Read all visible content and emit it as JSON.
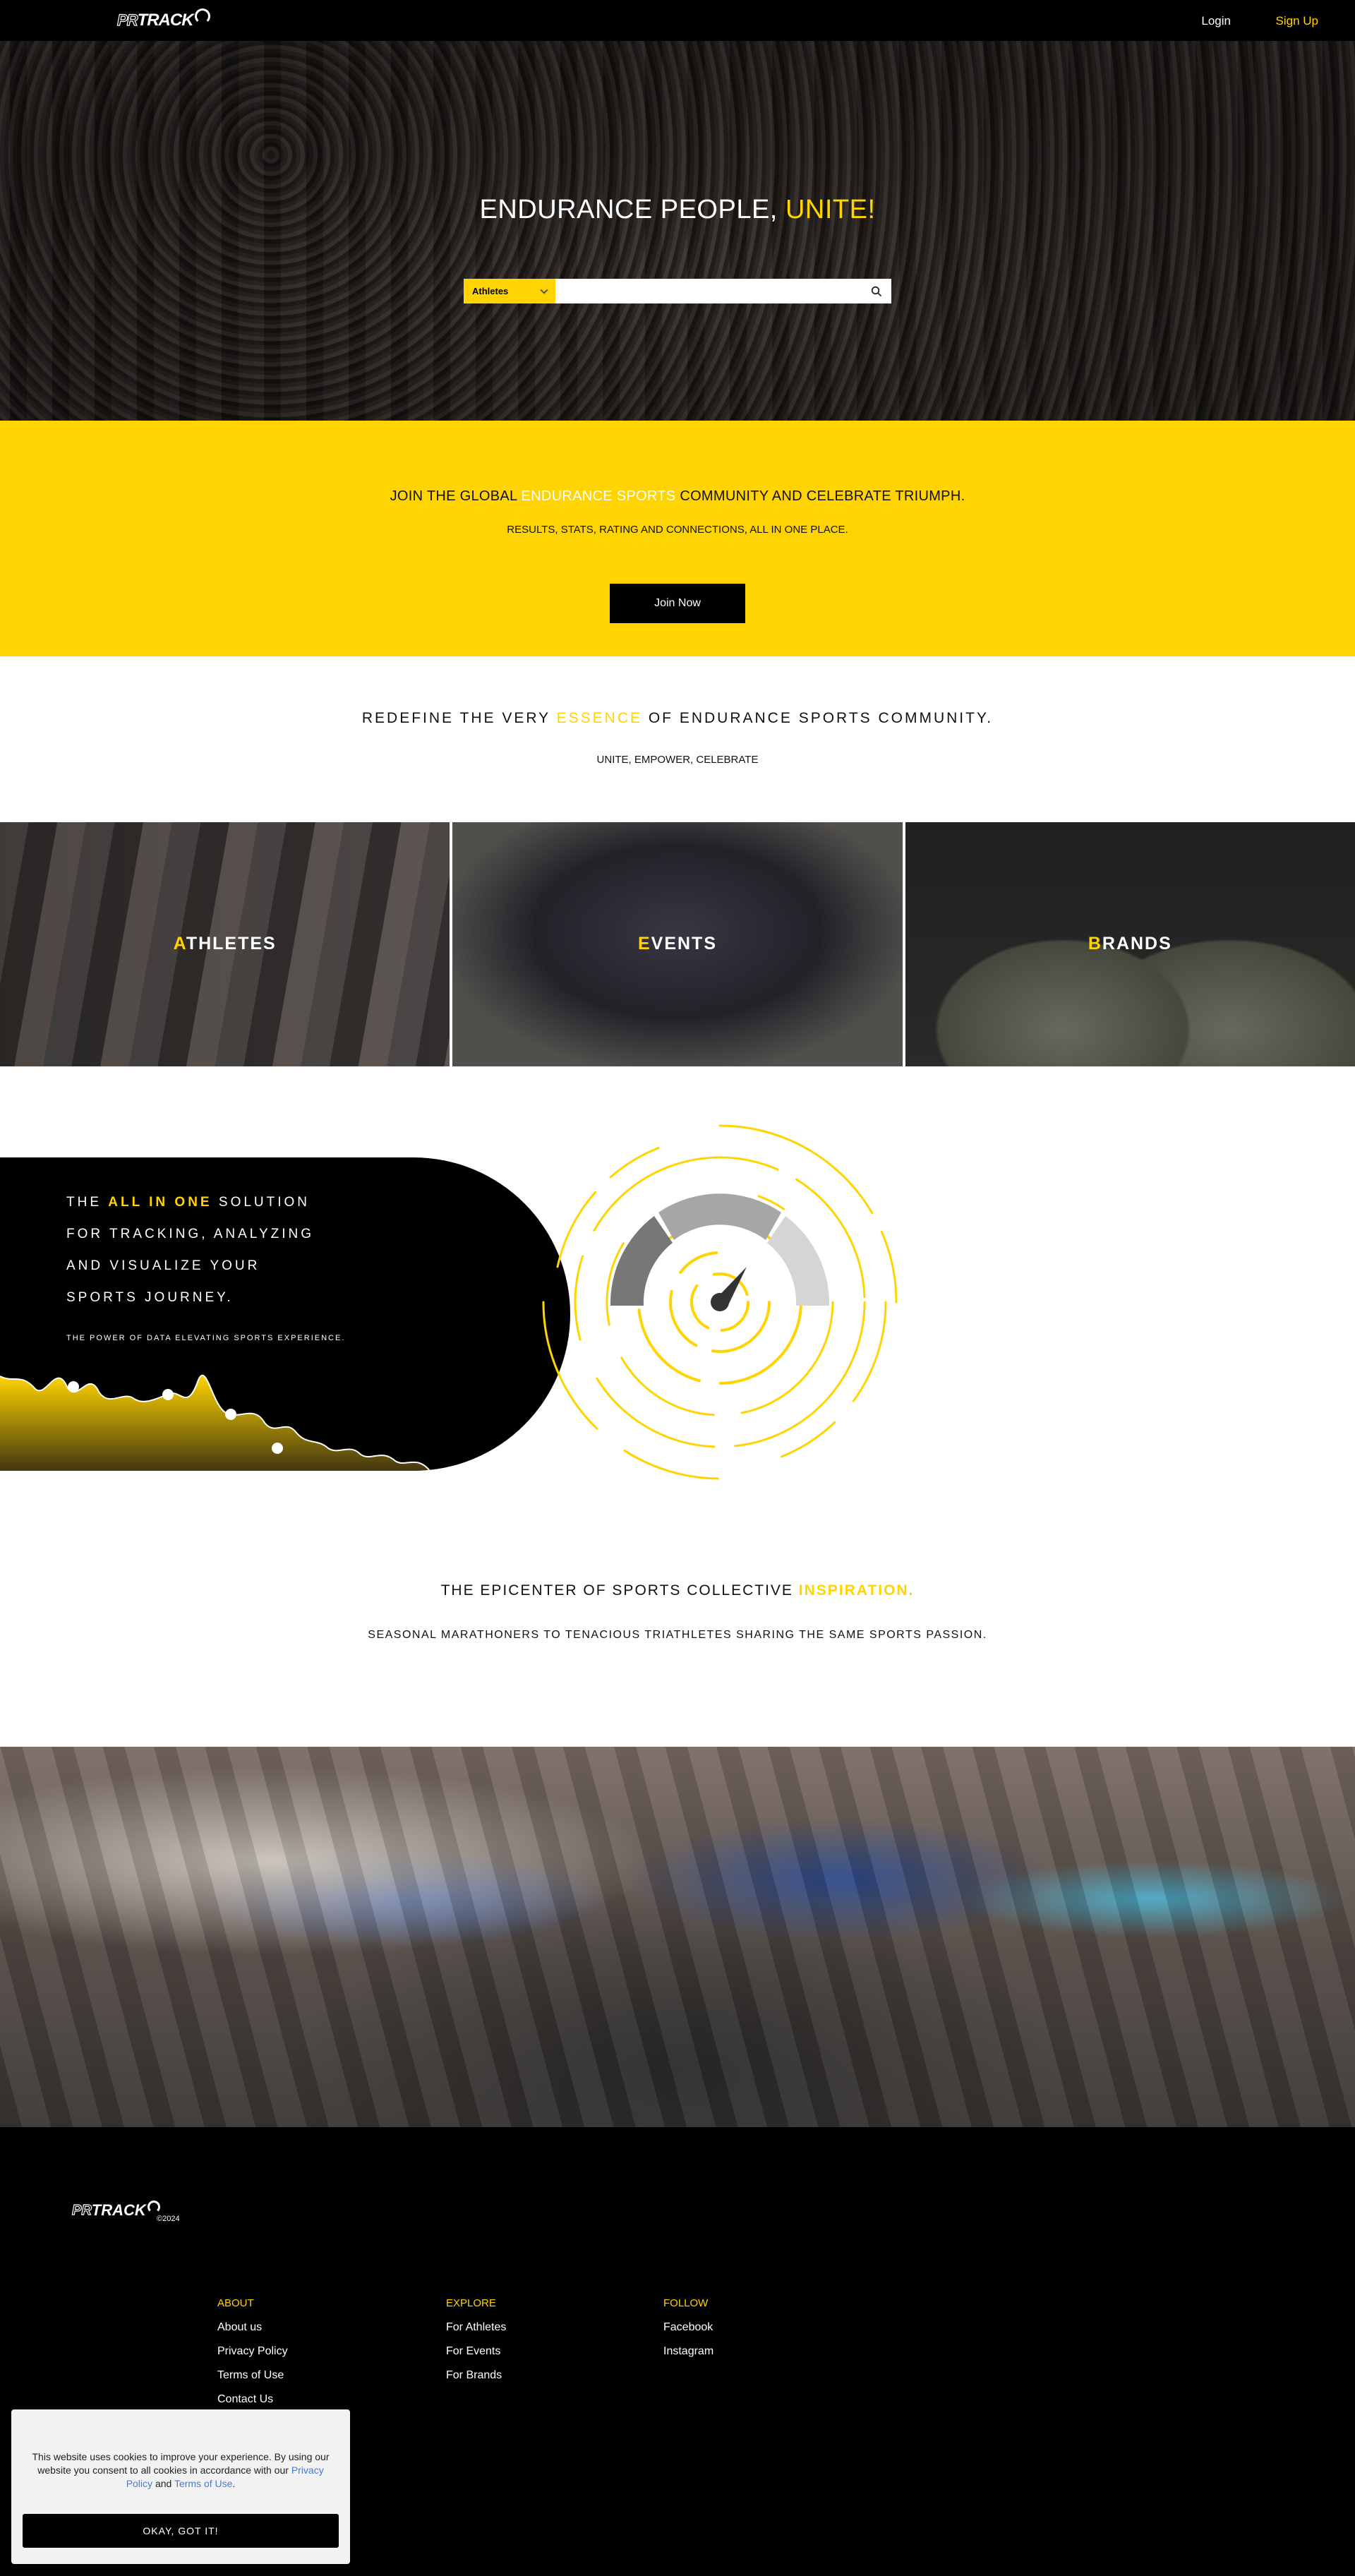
{
  "brand": {
    "logo_pr": "PR",
    "logo_track": "TRACK"
  },
  "nav": {
    "login": "Login",
    "signup": "Sign Up"
  },
  "hero": {
    "title_main": "ENDURANCE PEOPLE,",
    "title_accent": "UNITE!",
    "search": {
      "category": "Athletes",
      "placeholder": ""
    }
  },
  "join": {
    "title_before": "JOIN THE GLOBAL",
    "title_highlight": "ENDURANCE SPORTS",
    "title_after": "COMMUNITY AND CELEBRATE TRIUMPH.",
    "subtitle": "RESULTS, STATS, RATING AND CONNECTIONS, ALL IN ONE PLACE.",
    "button": "Join Now"
  },
  "redefine": {
    "title_before": "REDEFINE THE VERY",
    "title_highlight": "ESSENCE",
    "title_after": "OF ENDURANCE SPORTS COMMUNITY.",
    "subtitle": "UNITE, EMPOWER, CELEBRATE"
  },
  "categories": [
    {
      "first": "A",
      "rest": "THLETES"
    },
    {
      "first": "E",
      "rest": "VENTS"
    },
    {
      "first": "B",
      "rest": "RANDS"
    }
  ],
  "allinone": {
    "line1_before": "THE",
    "line1_highlight": "ALL IN ONE",
    "line1_after": "SOLUTION",
    "line2": "FOR TRACKING, ANALYZING",
    "line3": "AND  VISUALIZE YOUR",
    "line4": "SPORTS JOURNEY.",
    "subtitle": "THE POWER OF DATA ELEVATING SPORTS EXPERIENCE."
  },
  "epicenter": {
    "title_before": "THE EPICENTER OF SPORTS COLLECTIVE",
    "title_highlight": "INSPIRATION.",
    "subtitle": "SEASONAL MARATHONERS TO TENACIOUS TRIATHLETES SHARING THE SAME SPORTS PASSION."
  },
  "footer": {
    "copyright": "©2024",
    "columns": [
      {
        "heading": "ABOUT",
        "links": [
          "About us",
          "Privacy Policy",
          "Terms of Use",
          "Contact Us"
        ]
      },
      {
        "heading": "EXPLORE",
        "links": [
          "For Athletes",
          "For Events",
          "For Brands"
        ]
      },
      {
        "heading": "FOLLOW",
        "links": [
          "Facebook",
          "Instagram"
        ]
      }
    ]
  },
  "cookie": {
    "text": "This website uses cookies to improve your experience. By using our website you consent to all cookies in accordance with our",
    "privacy": "Privacy Policy",
    "and": "and",
    "terms": "Terms of Use",
    "end": ".",
    "button": "OKAY, GOT IT!"
  },
  "colors": {
    "accent": "#FFD400",
    "dark": "#000000"
  },
  "icons": {
    "search": "search-icon",
    "chevron": "chevron-down-icon",
    "logo_gauge": "speedometer-icon"
  }
}
